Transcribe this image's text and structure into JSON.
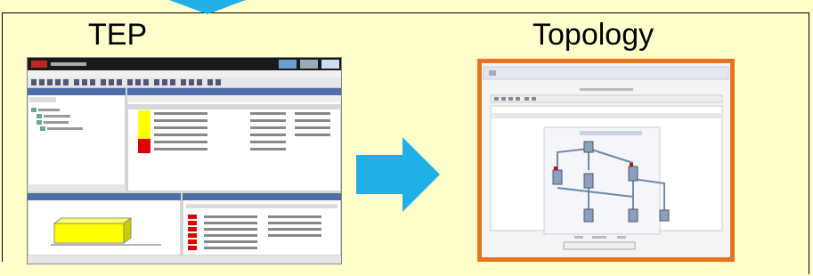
{
  "labels": {
    "tep": "TEP",
    "topology": "Topology"
  },
  "colors": {
    "background": "#ffffcc",
    "arrow": "#1fb0e8",
    "topology_border": "#e8731e"
  }
}
